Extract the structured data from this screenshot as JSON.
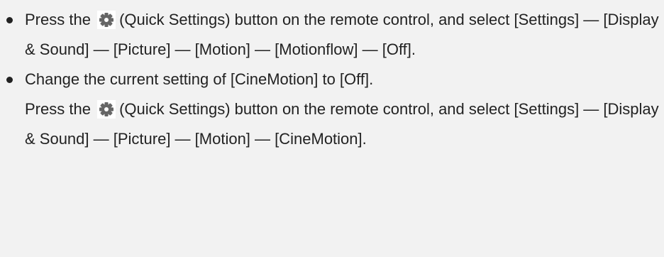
{
  "items": [
    {
      "paragraphs": [
        {
          "before_icon": "Press the",
          "icon": "gear-icon",
          "after_icon": "(Quick Settings) button on the remote control, and select [Settings] — [Display & Sound] — [Picture] — [Motion] — [Motionflow] — [Off]."
        }
      ]
    },
    {
      "paragraphs": [
        {
          "text": "Change the current setting of [CineMotion] to [Off]."
        },
        {
          "before_icon": "Press the",
          "icon": "gear-icon",
          "after_icon": "(Quick Settings) button on the remote control, and select [Settings] — [Display & Sound] — [Picture] — [Motion] — [CineMotion]."
        }
      ]
    }
  ],
  "colors": {
    "background": "#f2f2f2",
    "text": "#222222",
    "icon": "#666666"
  }
}
